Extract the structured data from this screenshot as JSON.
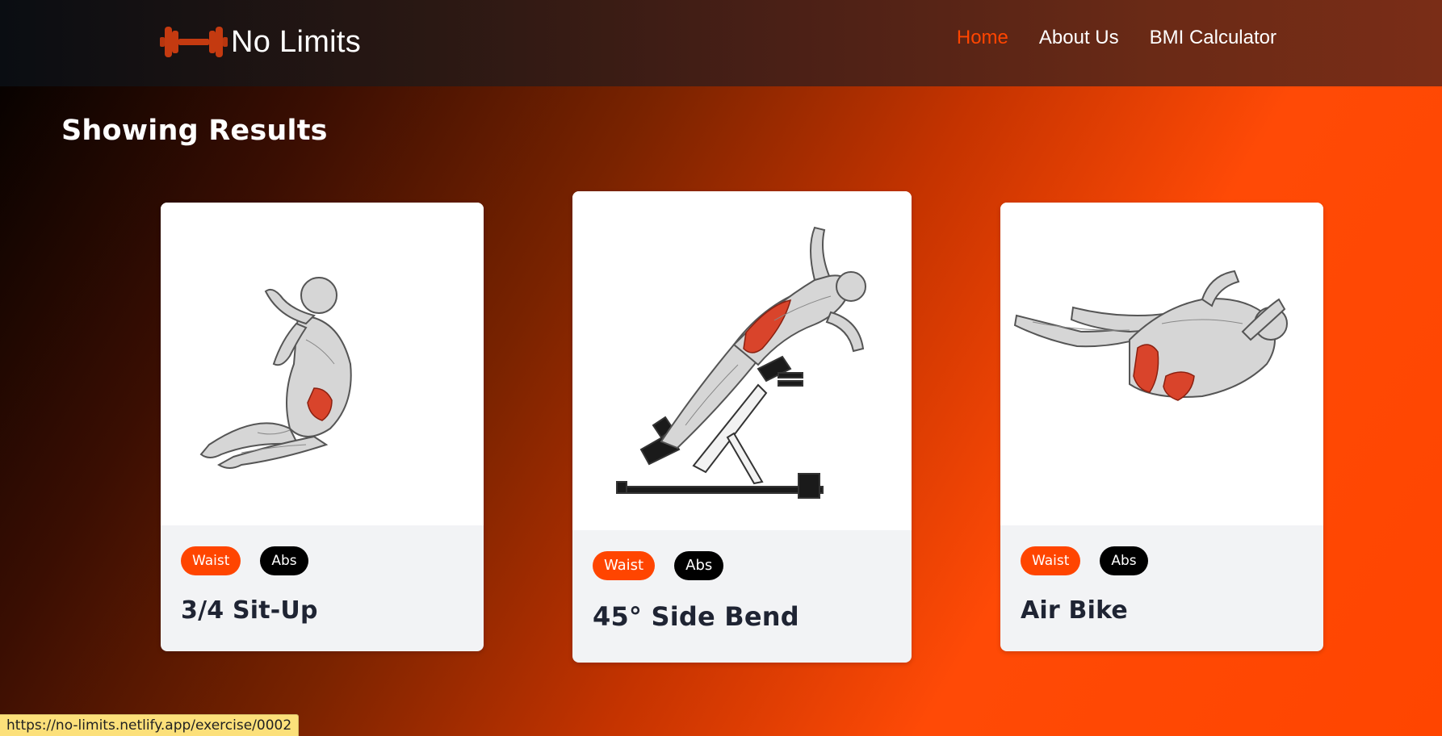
{
  "header": {
    "brand_name": "No Limits",
    "logo_icon": "dumbbell-icon",
    "nav": [
      {
        "label": "Home",
        "active": true
      },
      {
        "label": "About Us",
        "active": false
      },
      {
        "label": "BMI Calculator",
        "active": false
      }
    ]
  },
  "main": {
    "heading": "Showing Results",
    "cards": [
      {
        "name": "3/4 Sit-Up",
        "body_part": "Waist",
        "target": "Abs",
        "image_icon": "exercise-illustration-icon"
      },
      {
        "name": "45° Side Bend",
        "body_part": "Waist",
        "target": "Abs",
        "image_icon": "exercise-illustration-icon"
      },
      {
        "name": "Air Bike",
        "body_part": "Waist",
        "target": "Abs",
        "image_icon": "exercise-illustration-icon"
      }
    ]
  },
  "status_bar": {
    "url": "https://no-limits.netlify.app/exercise/0002"
  },
  "colors": {
    "accent": "#ff4500",
    "tag_target_bg": "#000000",
    "card_bg": "#f2f3f5",
    "title_text": "#1f2433"
  }
}
